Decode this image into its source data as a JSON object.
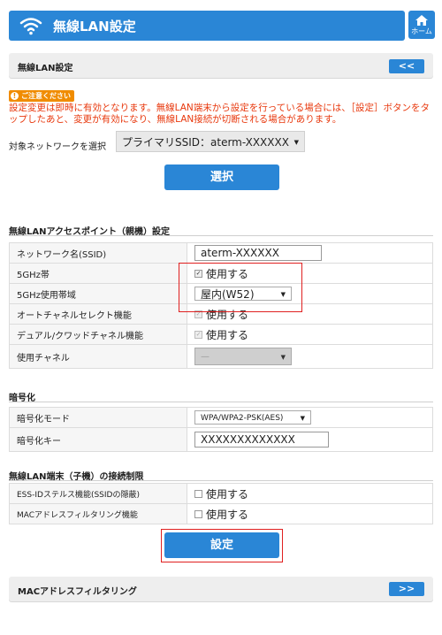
{
  "header": {
    "title": "無線LAN設定",
    "home_label": "ホーム"
  },
  "section_bar": {
    "label": "無線LAN設定",
    "nav": "<<"
  },
  "notice": {
    "badge": "ご注意ください",
    "text": "設定変更は即時に有効となります。無線LAN端末から設定を行っている場合には、［設定］ボタンをタップしたあと、変更が有効になり、無線LAN接続が切断される場合があります。"
  },
  "network_select": {
    "label": "対象ネットワークを選択",
    "value": "プライマリSSID：aterm-XXXXXX",
    "button": "選択"
  },
  "ap_section": {
    "title": "無線LANアクセスポイント（親機）設定",
    "rows": {
      "ssid": {
        "label": "ネットワーク名(SSID)",
        "value": "aterm-XXXXXX"
      },
      "band5": {
        "label": "5GHz帯",
        "option": "使用する"
      },
      "band5_use": {
        "label": "5GHz使用帯域",
        "value": "屋内(W52)"
      },
      "auto_channel": {
        "label": "オートチャネルセレクト機能",
        "option": "使用する"
      },
      "dual_channel": {
        "label": "デュアル/クワッドチャネル機能",
        "option": "使用する"
      },
      "channel": {
        "label": "使用チャネル",
        "value": "—"
      }
    }
  },
  "encryption": {
    "title": "暗号化",
    "mode": {
      "label": "暗号化モード",
      "value": "WPA/WPA2-PSK(AES)"
    },
    "key": {
      "label": "暗号化キー",
      "value": "XXXXXXXXXXXXX"
    }
  },
  "restriction": {
    "title": "無線LAN端末（子機）の接続制限",
    "stealth": {
      "label": "ESS-IDステルス機能(SSIDの隠蔽)",
      "option": "使用する"
    },
    "mac_filter": {
      "label": "MACアドレスフィルタリング機能",
      "option": "使用する"
    }
  },
  "apply_button": "設定",
  "mac_bar": {
    "label": "MACアドレスフィルタリング",
    "nav": ">>"
  },
  "colors": {
    "primary": "#2a86d6",
    "warning": "#e8380d",
    "caution_badge": "#f08c00",
    "highlight": "#e02020"
  }
}
